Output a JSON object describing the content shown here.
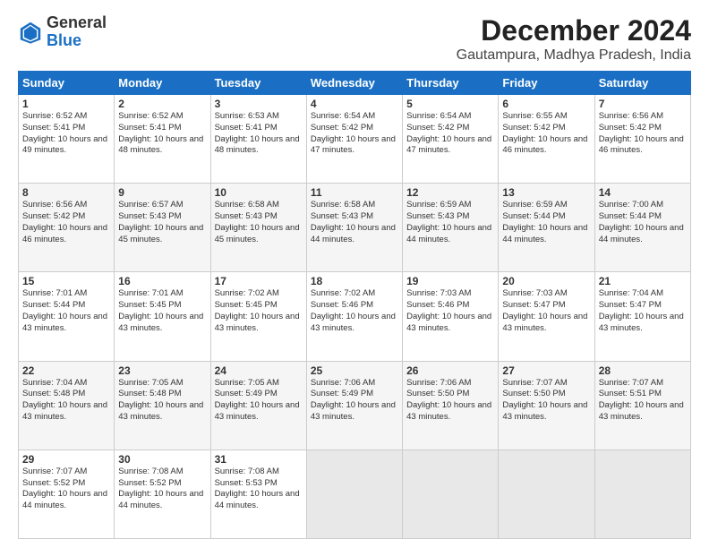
{
  "logo": {
    "general": "General",
    "blue": "Blue"
  },
  "title": "December 2024",
  "subtitle": "Gautampura, Madhya Pradesh, India",
  "headers": [
    "Sunday",
    "Monday",
    "Tuesday",
    "Wednesday",
    "Thursday",
    "Friday",
    "Saturday"
  ],
  "weeks": [
    [
      {
        "day": "1",
        "sunrise": "6:52 AM",
        "sunset": "5:41 PM",
        "daylight": "10 hours and 49 minutes."
      },
      {
        "day": "2",
        "sunrise": "6:52 AM",
        "sunset": "5:41 PM",
        "daylight": "10 hours and 48 minutes."
      },
      {
        "day": "3",
        "sunrise": "6:53 AM",
        "sunset": "5:41 PM",
        "daylight": "10 hours and 48 minutes."
      },
      {
        "day": "4",
        "sunrise": "6:54 AM",
        "sunset": "5:42 PM",
        "daylight": "10 hours and 47 minutes."
      },
      {
        "day": "5",
        "sunrise": "6:54 AM",
        "sunset": "5:42 PM",
        "daylight": "10 hours and 47 minutes."
      },
      {
        "day": "6",
        "sunrise": "6:55 AM",
        "sunset": "5:42 PM",
        "daylight": "10 hours and 46 minutes."
      },
      {
        "day": "7",
        "sunrise": "6:56 AM",
        "sunset": "5:42 PM",
        "daylight": "10 hours and 46 minutes."
      }
    ],
    [
      {
        "day": "8",
        "sunrise": "6:56 AM",
        "sunset": "5:42 PM",
        "daylight": "10 hours and 46 minutes."
      },
      {
        "day": "9",
        "sunrise": "6:57 AM",
        "sunset": "5:43 PM",
        "daylight": "10 hours and 45 minutes."
      },
      {
        "day": "10",
        "sunrise": "6:58 AM",
        "sunset": "5:43 PM",
        "daylight": "10 hours and 45 minutes."
      },
      {
        "day": "11",
        "sunrise": "6:58 AM",
        "sunset": "5:43 PM",
        "daylight": "10 hours and 44 minutes."
      },
      {
        "day": "12",
        "sunrise": "6:59 AM",
        "sunset": "5:43 PM",
        "daylight": "10 hours and 44 minutes."
      },
      {
        "day": "13",
        "sunrise": "6:59 AM",
        "sunset": "5:44 PM",
        "daylight": "10 hours and 44 minutes."
      },
      {
        "day": "14",
        "sunrise": "7:00 AM",
        "sunset": "5:44 PM",
        "daylight": "10 hours and 44 minutes."
      }
    ],
    [
      {
        "day": "15",
        "sunrise": "7:01 AM",
        "sunset": "5:44 PM",
        "daylight": "10 hours and 43 minutes."
      },
      {
        "day": "16",
        "sunrise": "7:01 AM",
        "sunset": "5:45 PM",
        "daylight": "10 hours and 43 minutes."
      },
      {
        "day": "17",
        "sunrise": "7:02 AM",
        "sunset": "5:45 PM",
        "daylight": "10 hours and 43 minutes."
      },
      {
        "day": "18",
        "sunrise": "7:02 AM",
        "sunset": "5:46 PM",
        "daylight": "10 hours and 43 minutes."
      },
      {
        "day": "19",
        "sunrise": "7:03 AM",
        "sunset": "5:46 PM",
        "daylight": "10 hours and 43 minutes."
      },
      {
        "day": "20",
        "sunrise": "7:03 AM",
        "sunset": "5:47 PM",
        "daylight": "10 hours and 43 minutes."
      },
      {
        "day": "21",
        "sunrise": "7:04 AM",
        "sunset": "5:47 PM",
        "daylight": "10 hours and 43 minutes."
      }
    ],
    [
      {
        "day": "22",
        "sunrise": "7:04 AM",
        "sunset": "5:48 PM",
        "daylight": "10 hours and 43 minutes."
      },
      {
        "day": "23",
        "sunrise": "7:05 AM",
        "sunset": "5:48 PM",
        "daylight": "10 hours and 43 minutes."
      },
      {
        "day": "24",
        "sunrise": "7:05 AM",
        "sunset": "5:49 PM",
        "daylight": "10 hours and 43 minutes."
      },
      {
        "day": "25",
        "sunrise": "7:06 AM",
        "sunset": "5:49 PM",
        "daylight": "10 hours and 43 minutes."
      },
      {
        "day": "26",
        "sunrise": "7:06 AM",
        "sunset": "5:50 PM",
        "daylight": "10 hours and 43 minutes."
      },
      {
        "day": "27",
        "sunrise": "7:07 AM",
        "sunset": "5:50 PM",
        "daylight": "10 hours and 43 minutes."
      },
      {
        "day": "28",
        "sunrise": "7:07 AM",
        "sunset": "5:51 PM",
        "daylight": "10 hours and 43 minutes."
      }
    ],
    [
      {
        "day": "29",
        "sunrise": "7:07 AM",
        "sunset": "5:52 PM",
        "daylight": "10 hours and 44 minutes."
      },
      {
        "day": "30",
        "sunrise": "7:08 AM",
        "sunset": "5:52 PM",
        "daylight": "10 hours and 44 minutes."
      },
      {
        "day": "31",
        "sunrise": "7:08 AM",
        "sunset": "5:53 PM",
        "daylight": "10 hours and 44 minutes."
      },
      null,
      null,
      null,
      null
    ]
  ]
}
